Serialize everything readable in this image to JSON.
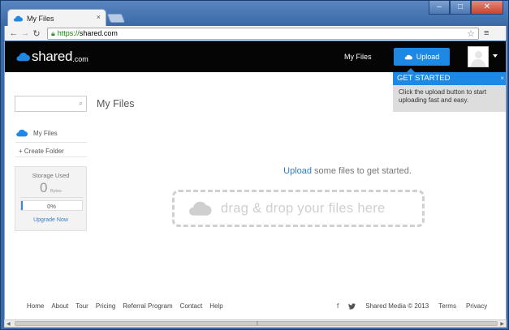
{
  "browser": {
    "tab_title": "My Files",
    "tab_close": "×",
    "address": {
      "scheme": "https://",
      "host": "shared.com"
    },
    "icons": {
      "back": "arrow-left-icon",
      "forward": "arrow-right-icon",
      "reload": "reload-icon",
      "lock": "lock-icon",
      "star": "star-icon",
      "menu": "hamburger-icon"
    },
    "window_controls": {
      "minimize": "‒",
      "maximize": "□",
      "close": "✕"
    }
  },
  "header": {
    "brand": "shared",
    "brand_tld": ".com",
    "nav_myfiles": "My Files",
    "upload_label": "Upload",
    "accent_color": "#1e88e5"
  },
  "popover": {
    "title": "GET STARTED",
    "close": "×",
    "body": "Click the upload button to start uploading fast and easy."
  },
  "sidebar": {
    "search": {
      "value": "",
      "placeholder": ""
    },
    "my_files": "My Files",
    "create_folder": "+ Create Folder",
    "storage": {
      "title": "Storage Used",
      "value": "0",
      "unit": "Bytes",
      "percent_label": "0%",
      "percent": 0,
      "upgrade": "Upgrade Now"
    }
  },
  "main": {
    "title": "My Files",
    "prompt_link": "Upload",
    "prompt_rest": " some files to get started.",
    "dropzone_text": "drag & drop your files here"
  },
  "footer": {
    "links": [
      "Home",
      "About",
      "Tour",
      "Pricing",
      "Referral Program",
      "Contact",
      "Help"
    ],
    "facebook": "f",
    "copyright": "Shared Media © 2013",
    "terms": "Terms",
    "privacy": "Privacy"
  }
}
